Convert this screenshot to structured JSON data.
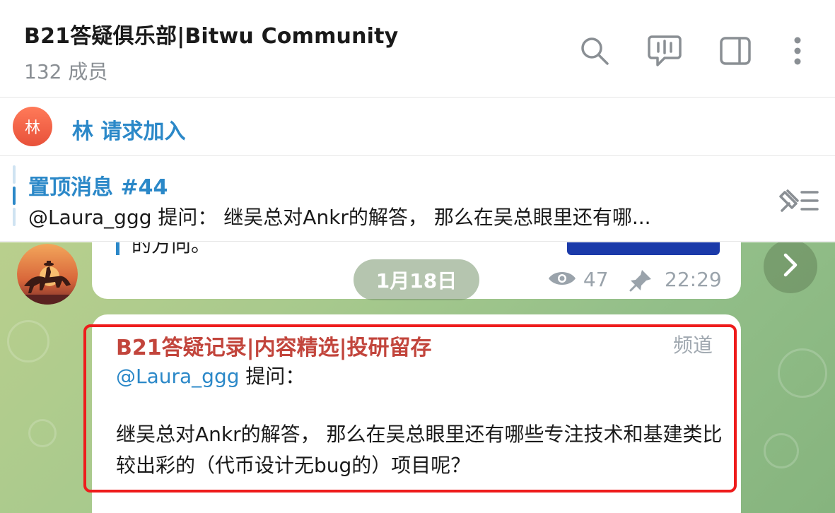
{
  "header": {
    "title": "B21答疑俱乐部|Bitwu Community",
    "member_count": "132 成员",
    "icons": [
      "search-icon",
      "live-chat-icon",
      "sidebar-toggle-icon",
      "more-vertical-icon"
    ]
  },
  "join_request": {
    "avatar_letter": "林",
    "text": "林 请求加入",
    "avatar_color": "#e8513a"
  },
  "pinned": {
    "title": "置顶消息 #44",
    "preview": "@Laura_ggg 提问：  继吴总对Ankr的解答， 那么在吴总眼里还有哪..."
  },
  "previous_message": {
    "partial_text": "的方向。",
    "views": "47",
    "time": "22:29"
  },
  "date_divider": "1月18日",
  "message": {
    "channel_name": "B21答疑记录|内容精选|投研留存",
    "tag": "频道",
    "mention": "@Laura_ggg",
    "mention_suffix": " 提问：",
    "body": "继吴总对Ankr的解答， 那么在吴总眼里还有哪些专注技术和基建类比较出彩的（代币设计无bug的）项目呢？"
  },
  "colors": {
    "accent_blue": "#2b88c8",
    "channel_red": "#c2453c",
    "highlight_box": "#ee1c1c"
  }
}
